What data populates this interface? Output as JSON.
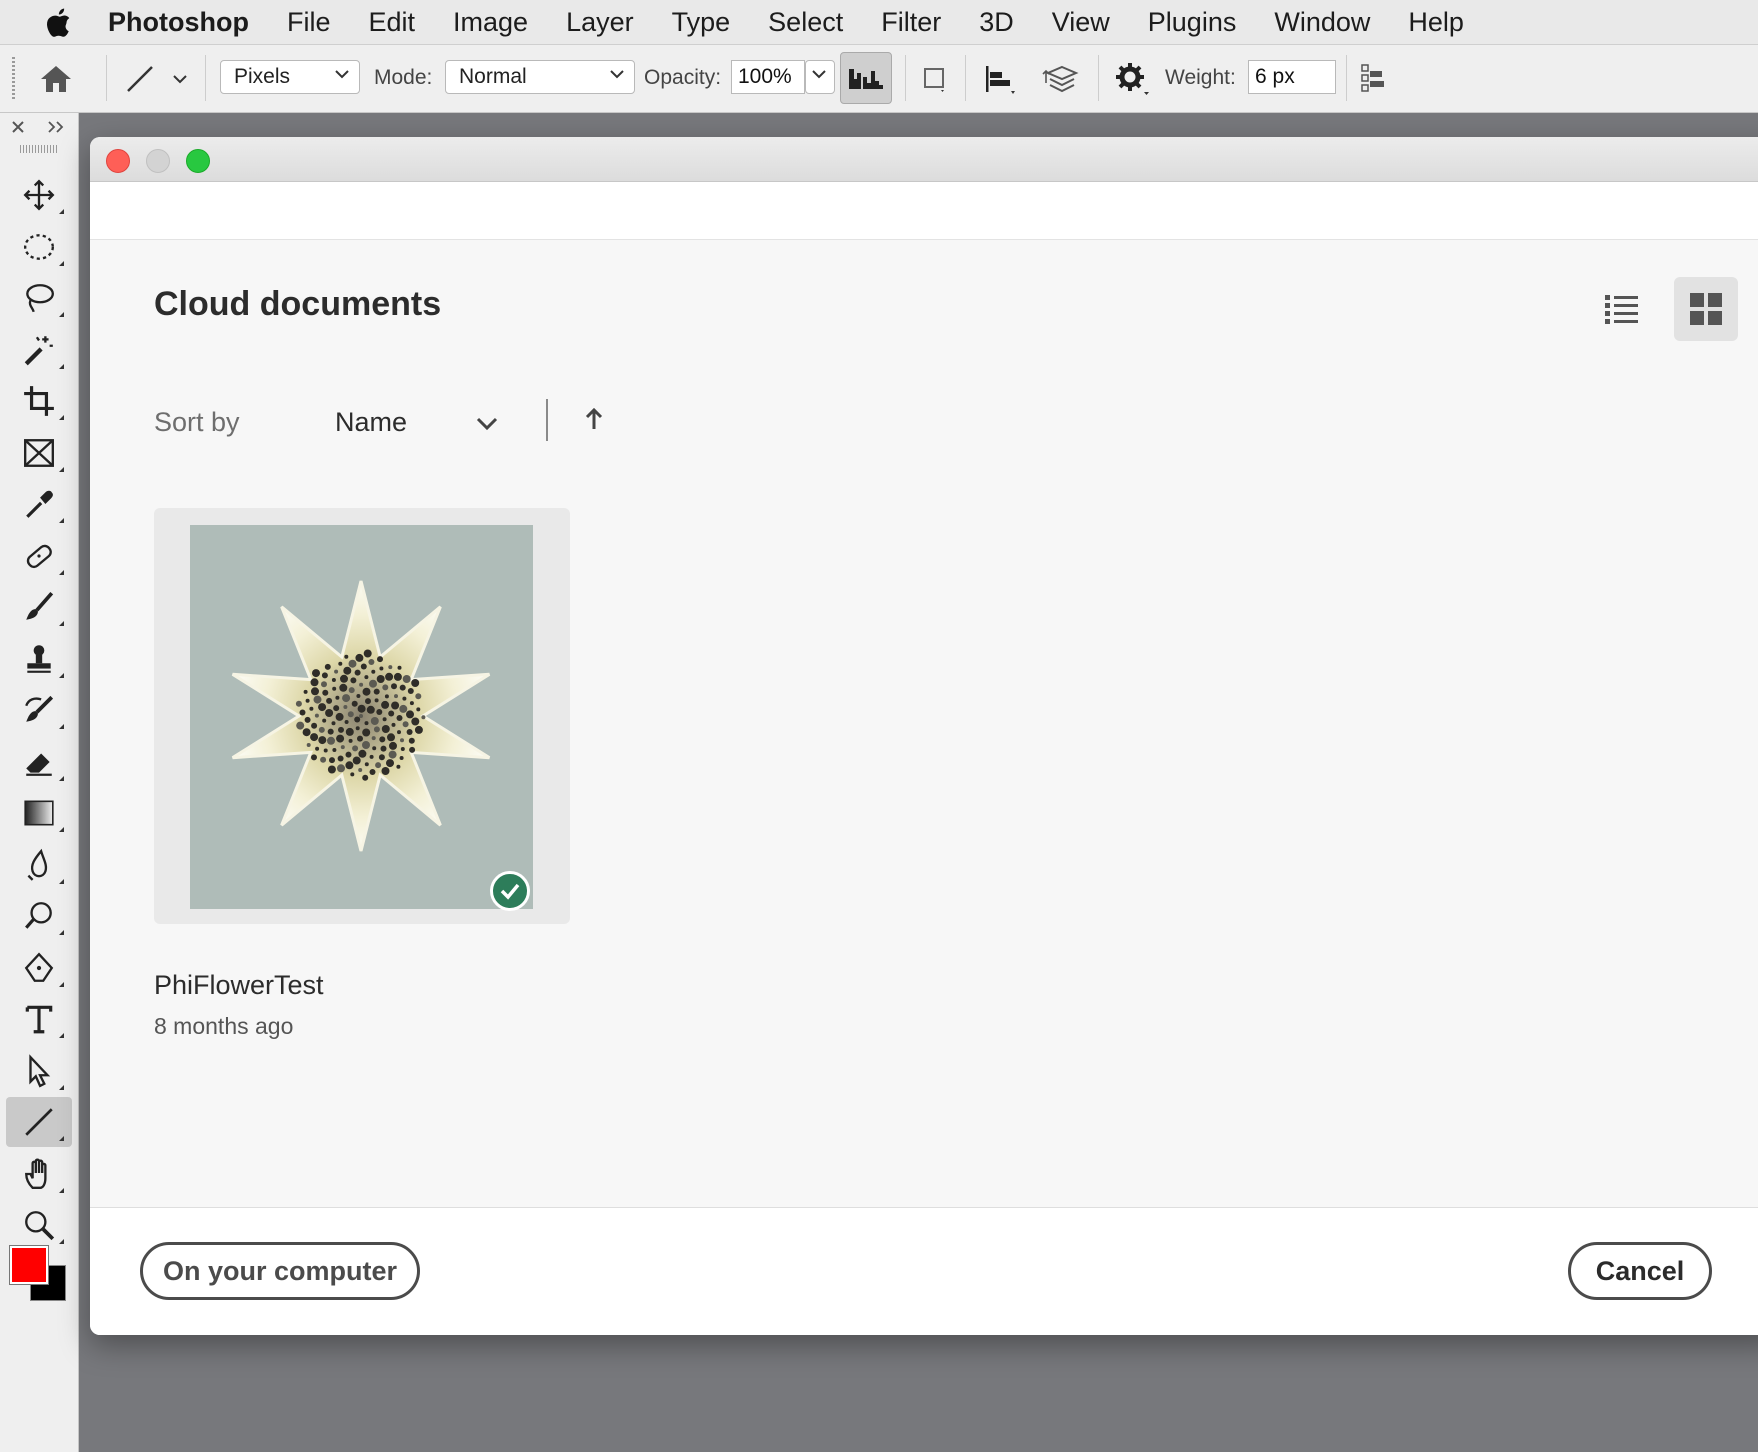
{
  "menubar": {
    "app_name": "Photoshop",
    "items": [
      "File",
      "Edit",
      "Image",
      "Layer",
      "Type",
      "Select",
      "Filter",
      "3D",
      "View",
      "Plugins",
      "Window",
      "Help"
    ]
  },
  "options_bar": {
    "tool_icon": "line-tool-icon",
    "fill_type": "Pixels",
    "mode_label": "Mode:",
    "mode_value": "Normal",
    "opacity_label": "Opacity:",
    "opacity_value": "100%",
    "weight_label": "Weight:",
    "weight_value": "6 px"
  },
  "toolbar": {
    "tools": [
      "move",
      "elliptical-marquee",
      "lasso",
      "magic-wand",
      "crop",
      "frame",
      "eyedropper",
      "healing-brush",
      "brush",
      "clone-stamp",
      "history-brush",
      "eraser",
      "gradient",
      "blur",
      "dodge",
      "pen",
      "type",
      "path-selection",
      "line",
      "hand",
      "zoom",
      "more"
    ],
    "active_tool": "line",
    "foreground_color": "#ff0000",
    "background_color": "#000000"
  },
  "dialog": {
    "title": "Cloud documents",
    "sort_label": "Sort by",
    "sort_value": "Name",
    "sort_direction": "ascending",
    "view_mode": "grid",
    "documents": [
      {
        "name": "PhiFlowerTest",
        "modified": "8 months ago",
        "synced": true
      }
    ],
    "buttons": {
      "local": "On your computer",
      "cancel": "Cancel"
    }
  },
  "colors": {
    "thumbnail_bg": "#afbcb8",
    "sync_badge": "#2d7d5a"
  }
}
